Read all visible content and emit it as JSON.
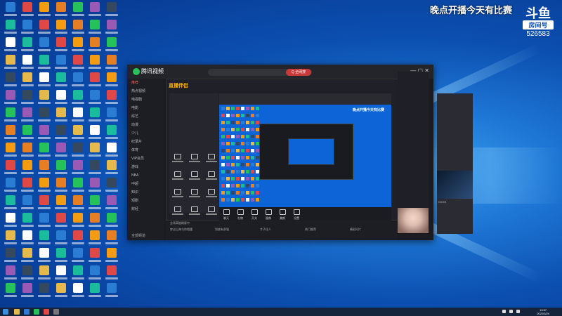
{
  "stream_overlay": {
    "title": "晚点开播今天有比赛",
    "platform": "斗鱼",
    "room_label": "房间号",
    "room_number": "526583"
  },
  "app": {
    "name": "腾讯视频",
    "search_button": "Q 全网搜",
    "sidebar_items": [
      "推荐",
      "热点视频",
      "电视剧",
      "电影",
      "综艺",
      "动漫",
      "少儿",
      "纪录片",
      "体育",
      "VIP会员",
      "游戏",
      "NBA",
      "中超",
      "知识",
      "短剧",
      "财经"
    ],
    "sidebar_bottom": "全部频道",
    "bottom_notice": "全场高能刷屏中"
  },
  "inner_app": {
    "title_main": "直播伴侣",
    "title_prefix": "",
    "overlay_text": "晚点开播今天有比赛",
    "controls": [
      "聊天",
      "礼物",
      "开关",
      "摄像",
      "美颜",
      "设置"
    ],
    "bottom_items": [
      "穿过山海与你相遇",
      "到底有多强",
      "才子佳人",
      "热门推荐",
      "精彩好片"
    ]
  },
  "taskbar": {
    "time": "13:57",
    "date": "2022/3/24"
  },
  "colors": {
    "accent_red": "#c83a3a",
    "desktop_blue": "#0b4fb0",
    "app_bg": "#1b1c22"
  }
}
